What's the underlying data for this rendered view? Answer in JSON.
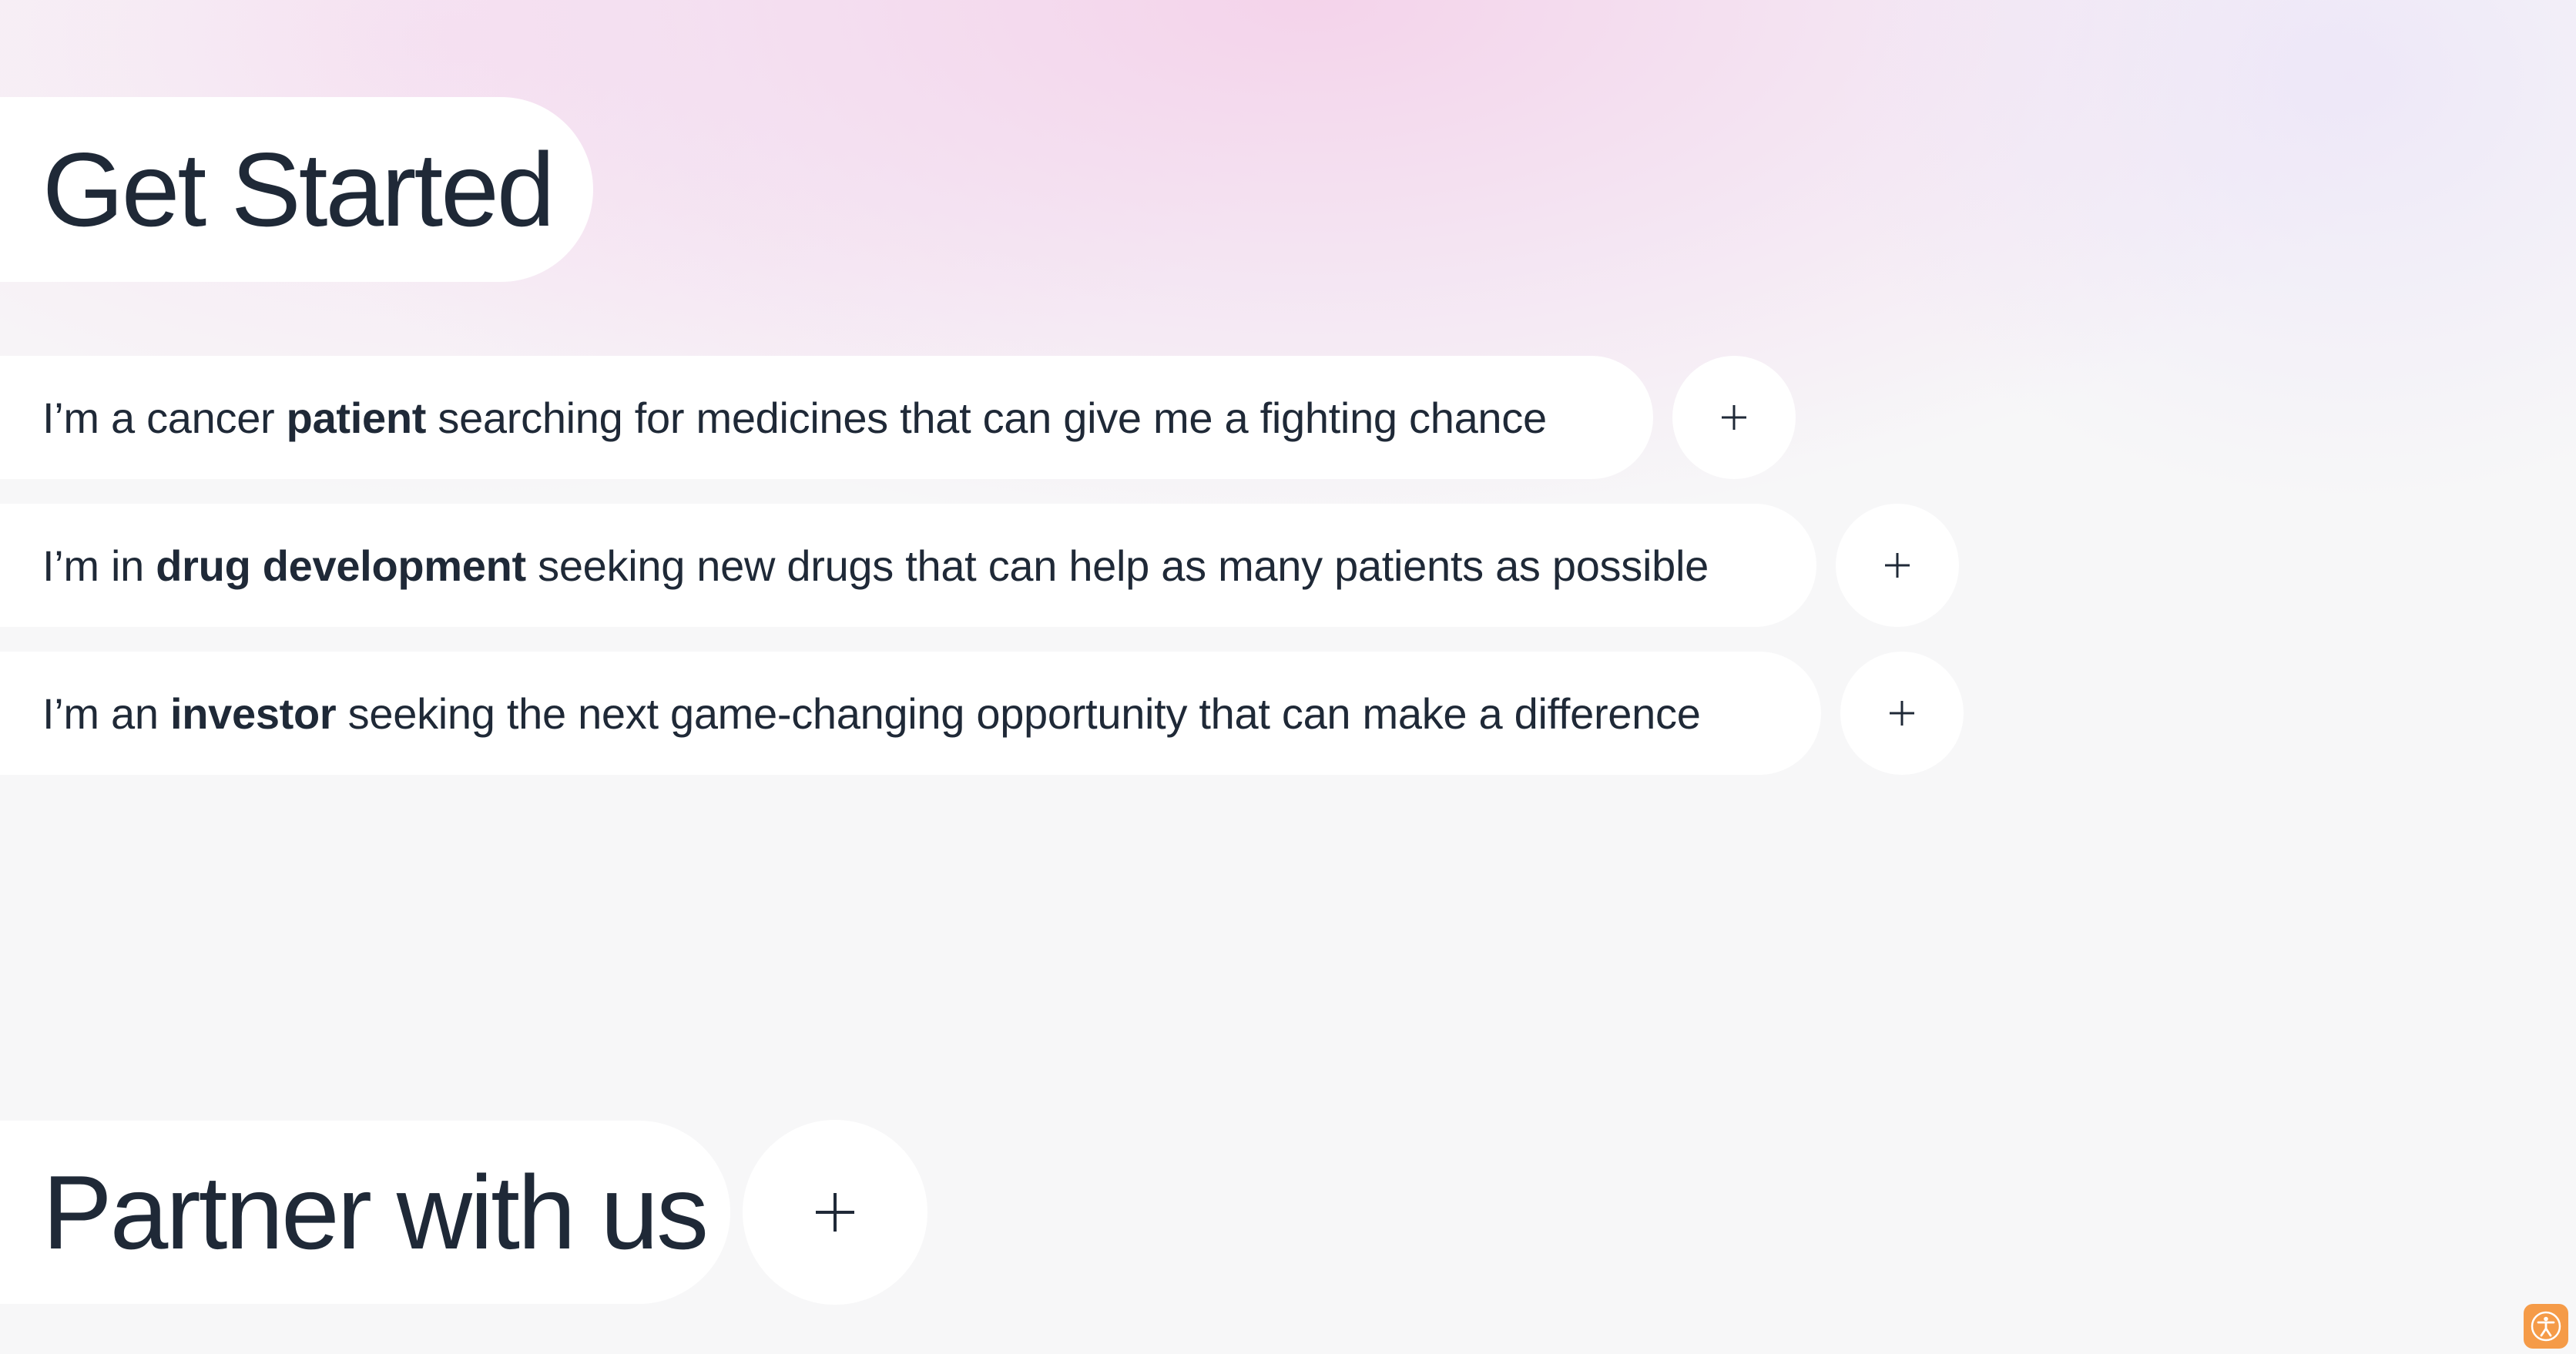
{
  "get_started": {
    "title": "Get Started"
  },
  "options": [
    {
      "prefix": "I’m a cancer ",
      "bold": "patient",
      "suffix": " searching for medicines that can give me a fighting chance",
      "expand_icon": "plus-icon"
    },
    {
      "prefix": "I’m in ",
      "bold": "drug development",
      "suffix": " seeking new drugs that can help as many patients as possible",
      "expand_icon": "plus-icon"
    },
    {
      "prefix": "I’m an ",
      "bold": "investor",
      "suffix": " seeking the next game-changing opportunity that can make a difference",
      "expand_icon": "plus-icon"
    }
  ],
  "partner": {
    "title": "Partner with us",
    "expand_icon": "plus-icon"
  },
  "accessibility_widget": {
    "icon": "accessibility-icon",
    "color": "#f59b48"
  },
  "colors": {
    "text": "#1f2937",
    "pill_background": "#ffffff",
    "page_background": "#f7f7f8",
    "gradient_pink": "#f3cde8",
    "gradient_lavender": "#ece5f8"
  }
}
